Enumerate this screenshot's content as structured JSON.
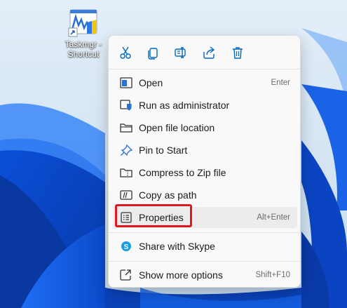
{
  "desktop": {
    "icon_label_line1": "Taskmgr -",
    "icon_label_line2": "Shortcut",
    "icon": "task-manager-icon"
  },
  "context_menu": {
    "toolbar": [
      {
        "name": "cut",
        "icon": "scissors-icon"
      },
      {
        "name": "copy",
        "icon": "copy-icon"
      },
      {
        "name": "rename",
        "icon": "rename-icon"
      },
      {
        "name": "share",
        "icon": "share-icon"
      },
      {
        "name": "delete",
        "icon": "trash-icon"
      }
    ],
    "items": [
      {
        "label": "Open",
        "shortcut": "Enter",
        "icon": "window-icon"
      },
      {
        "label": "Run as administrator",
        "shortcut": "",
        "icon": "shield-icon"
      },
      {
        "label": "Open file location",
        "shortcut": "",
        "icon": "folder-icon"
      },
      {
        "label": "Pin to Start",
        "shortcut": "",
        "icon": "pin-icon"
      },
      {
        "label": "Compress to Zip file",
        "shortcut": "",
        "icon": "zip-folder-icon"
      },
      {
        "label": "Copy as path",
        "shortcut": "",
        "icon": "path-icon"
      },
      {
        "label": "Properties",
        "shortcut": "Alt+Enter",
        "icon": "properties-icon",
        "highlighted": true
      },
      {
        "label": "Share with Skype",
        "shortcut": "",
        "icon": "skype-icon"
      },
      {
        "label": "Show more options",
        "shortcut": "Shift+F10",
        "icon": "expand-icon"
      }
    ],
    "accent_color": "#0067c0",
    "highlight_color": "#e3151f"
  }
}
